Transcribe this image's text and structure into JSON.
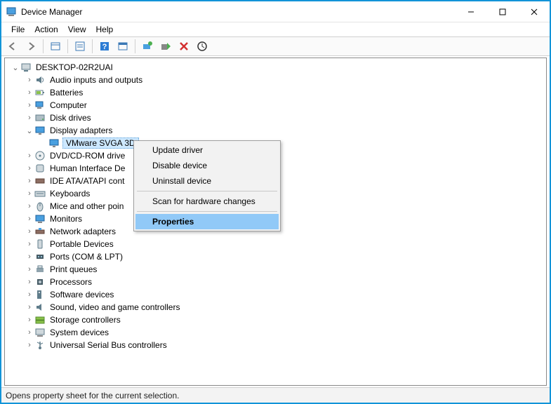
{
  "window": {
    "title": "Device Manager"
  },
  "menus": {
    "file": "File",
    "action": "Action",
    "view": "View",
    "help": "Help"
  },
  "toolbar_icons": [
    "back",
    "forward",
    "show-hidden",
    "properties-sheet",
    "help",
    "find",
    "monitor",
    "config",
    "delete",
    "scan"
  ],
  "tree": {
    "root": {
      "label": "DESKTOP-02R2UAI",
      "expanded": true
    },
    "items": [
      {
        "label": "Audio inputs and outputs",
        "icon": "audio",
        "expanded": false
      },
      {
        "label": "Batteries",
        "icon": "battery",
        "expanded": false
      },
      {
        "label": "Computer",
        "icon": "computer",
        "expanded": false
      },
      {
        "label": "Disk drives",
        "icon": "disk",
        "expanded": false
      },
      {
        "label": "Display adapters",
        "icon": "display",
        "expanded": true,
        "children": [
          {
            "label": "VMware SVGA 3D",
            "icon": "display",
            "selected": true
          }
        ]
      },
      {
        "label": "DVD/CD-ROM drive",
        "icon": "dvd",
        "expanded": false
      },
      {
        "label": "Human Interface De",
        "icon": "hid",
        "expanded": false
      },
      {
        "label": "IDE ATA/ATAPI cont",
        "icon": "ide",
        "expanded": false
      },
      {
        "label": "Keyboards",
        "icon": "keyboard",
        "expanded": false
      },
      {
        "label": "Mice and other poin",
        "icon": "mouse",
        "expanded": false
      },
      {
        "label": "Monitors",
        "icon": "monitor",
        "expanded": false
      },
      {
        "label": "Network adapters",
        "icon": "network",
        "expanded": false
      },
      {
        "label": "Portable Devices",
        "icon": "portable",
        "expanded": false
      },
      {
        "label": "Ports (COM & LPT)",
        "icon": "port",
        "expanded": false
      },
      {
        "label": "Print queues",
        "icon": "printer",
        "expanded": false
      },
      {
        "label": "Processors",
        "icon": "cpu",
        "expanded": false
      },
      {
        "label": "Software devices",
        "icon": "software",
        "expanded": false
      },
      {
        "label": "Sound, video and game controllers",
        "icon": "sound",
        "expanded": false
      },
      {
        "label": "Storage controllers",
        "icon": "storage",
        "expanded": false
      },
      {
        "label": "System devices",
        "icon": "system",
        "expanded": false
      },
      {
        "label": "Universal Serial Bus controllers",
        "icon": "usb",
        "expanded": false
      }
    ]
  },
  "context_menu": {
    "items": [
      {
        "label": "Update driver"
      },
      {
        "label": "Disable device"
      },
      {
        "label": "Uninstall device"
      },
      {
        "sep": true
      },
      {
        "label": "Scan for hardware changes"
      },
      {
        "sep": true
      },
      {
        "label": "Properties",
        "highlighted": true
      }
    ]
  },
  "statusbar": {
    "text": "Opens property sheet for the current selection."
  }
}
